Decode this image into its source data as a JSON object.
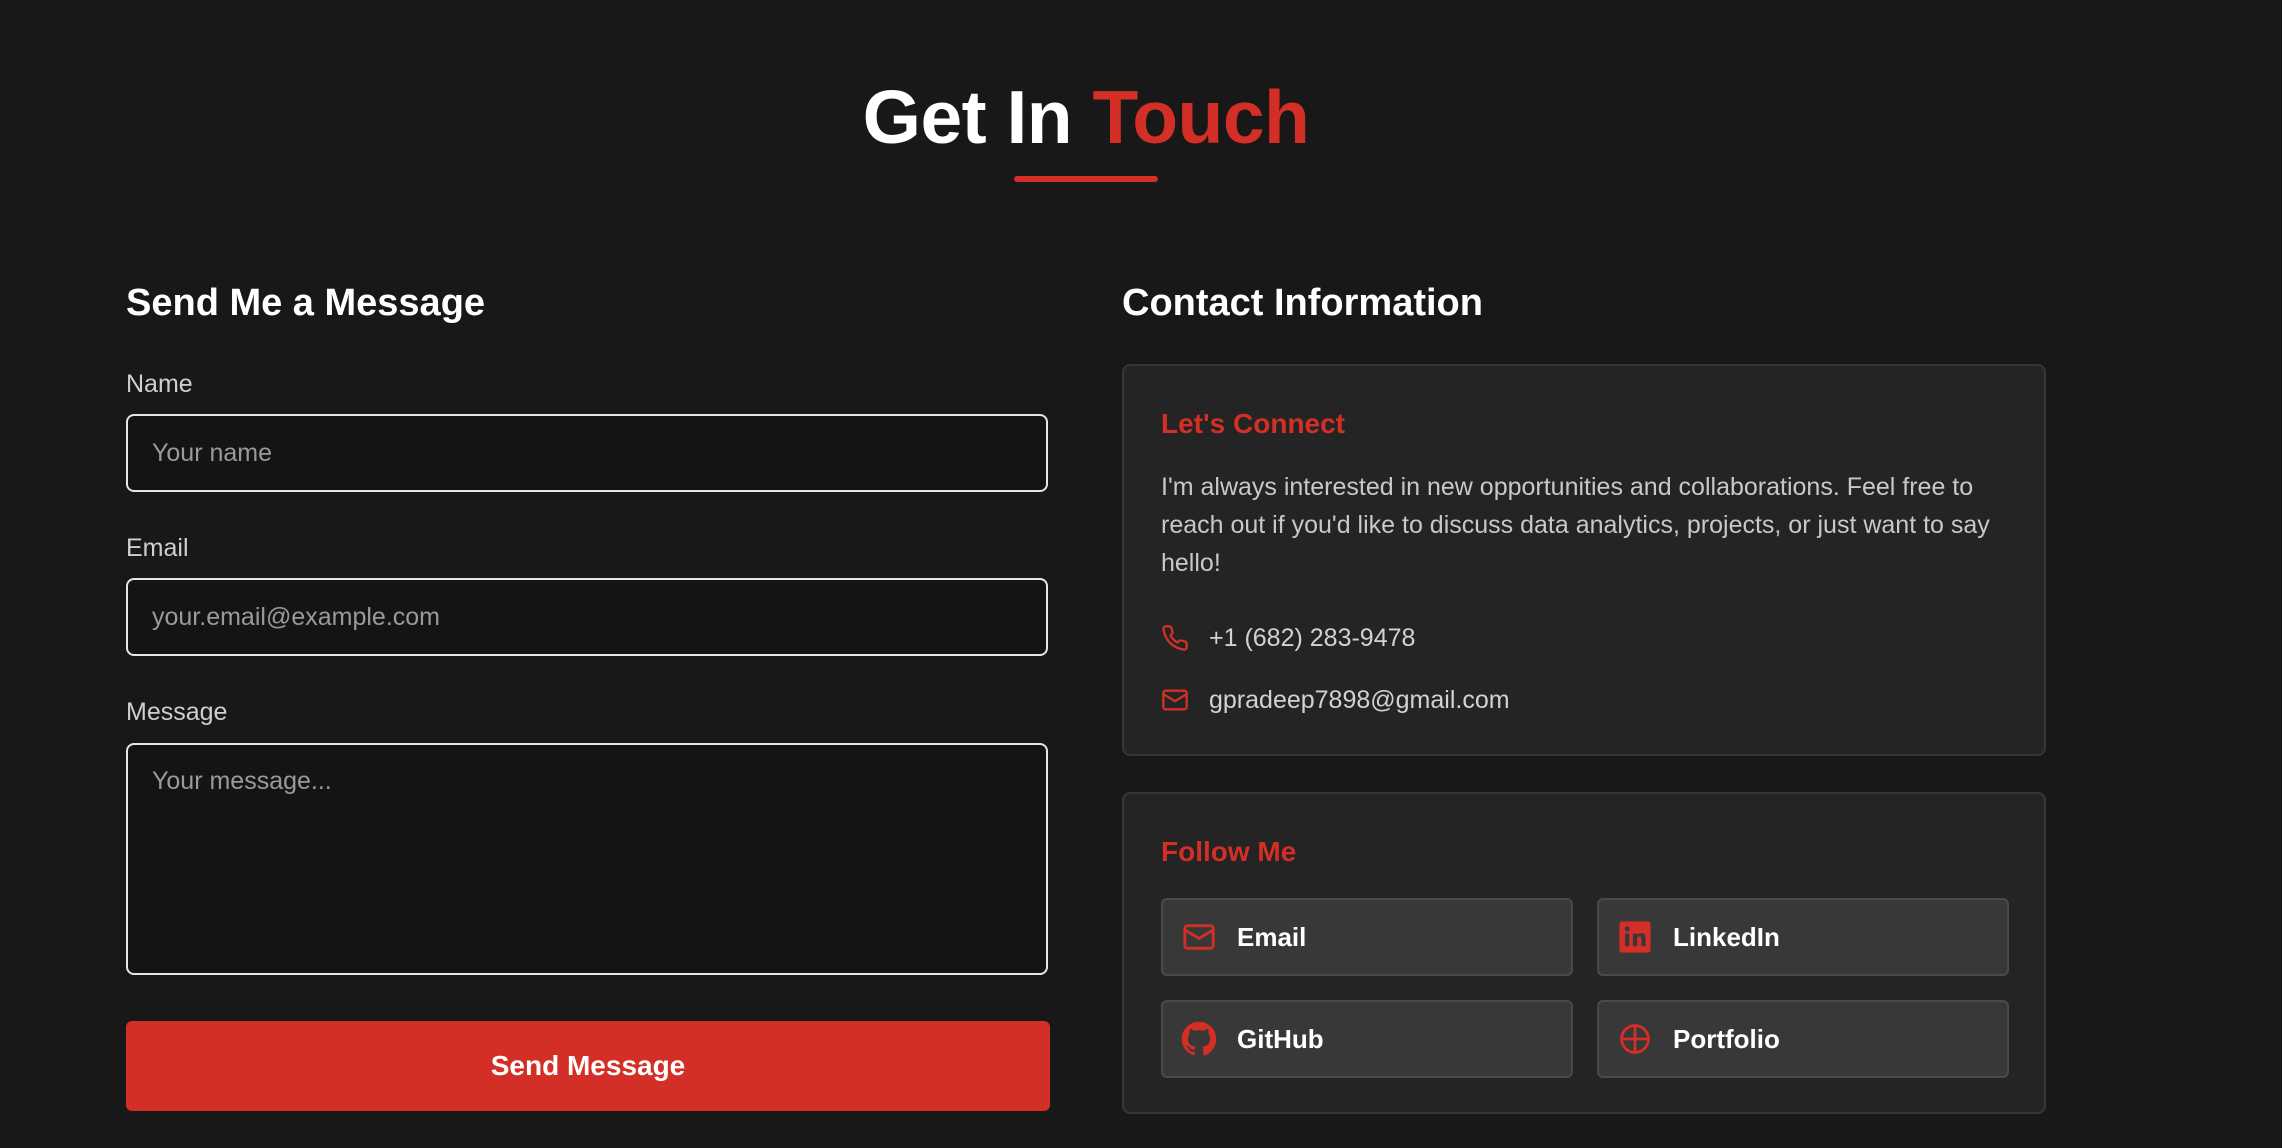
{
  "header": {
    "title_part1": "Get In ",
    "title_part2": "Touch"
  },
  "form": {
    "title": "Send Me a Message",
    "name_label": "Name",
    "name_placeholder": "Your name",
    "name_value": "",
    "email_label": "Email",
    "email_placeholder": "your.email@example.com",
    "email_value": "",
    "message_label": "Message",
    "message_placeholder": "Your message...",
    "message_value": "",
    "submit_label": "Send Message"
  },
  "contact": {
    "title": "Contact Information",
    "connect_title": "Let's Connect",
    "description": "I'm always interested in new opportunities and collaborations. Feel free to reach out if you'd like to discuss data analytics, projects, or just want to say hello!",
    "phone": "+1 (682) 283-9478",
    "email": "gpradeep7898@gmail.com"
  },
  "social": {
    "title": "Follow Me",
    "links": [
      {
        "label": "Email",
        "icon": "mail-icon"
      },
      {
        "label": "LinkedIn",
        "icon": "linkedin-icon"
      },
      {
        "label": "GitHub",
        "icon": "github-icon"
      },
      {
        "label": "Portfolio",
        "icon": "globe-icon"
      }
    ]
  },
  "colors": {
    "accent": "#d32f27",
    "background": "#181818",
    "card": "#242424",
    "social_button": "#383838"
  }
}
